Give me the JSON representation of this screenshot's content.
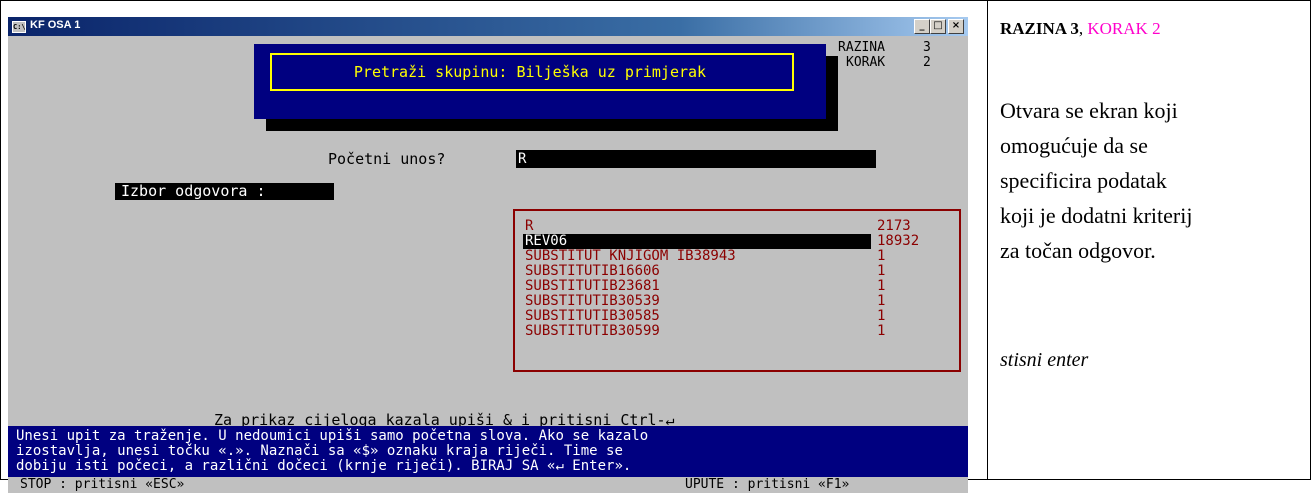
{
  "window": {
    "title": "KF OSA 1",
    "btn_min": "_",
    "btn_max": "□",
    "btn_close": "×"
  },
  "header": {
    "title": "Pretraži skupinu: Bilješka uz primjerak",
    "razina_label": "RAZINA",
    "razina_value": "3",
    "korak_label": "KORAK",
    "korak_value": "2"
  },
  "prompt": {
    "label": "Početni unos?",
    "value": "R"
  },
  "izbor_label": "Izbor odgovora :",
  "results": [
    {
      "name": "R",
      "count": "2173"
    },
    {
      "name": "REV06",
      "count": "18932",
      "selected": true
    },
    {
      "name": "SUBSTITUT KNJIGOM IB38943",
      "count": "1"
    },
    {
      "name": "SUBSTITUTIB16606",
      "count": "1"
    },
    {
      "name": "SUBSTITUTIB23681",
      "count": "1"
    },
    {
      "name": "SUBSTITUTIB30539",
      "count": "1"
    },
    {
      "name": "SUBSTITUTIB30585",
      "count": "1"
    },
    {
      "name": "SUBSTITUTIB30599",
      "count": "1"
    }
  ],
  "hint": "Za prikaz cijeloga kazala upiši & i pritisni Ctrl-↵",
  "help_lines": [
    "Unesi upit za traženje. U nedoumici upiši samo početna slova. Ako se kazalo",
    "izostavlja, unesi točku «.». Naznači sa «$» oznaku kraja riječi. Time se",
    "dobiju isti počeci, a različni dočeci (krnje riječi). BIRAJ SA «↵ Enter»."
  ],
  "status": {
    "left": "STOP : pritisni «ESC»",
    "right": "UPUTE : pritisni «F1»"
  },
  "sidebar": {
    "razina_bold": "RAZINA 3",
    "sep": ",",
    "korak": "KORAK 2",
    "body_lines": [
      "Otvara se ekran koji",
      "omogućuje da se",
      "specificira  podatak",
      "koji je dodatni kriterij",
      "za točan odgovor."
    ],
    "action": "stisni  enter"
  },
  "colors": {
    "console_bg": "#c0c0c0",
    "navy": "#000080",
    "highlight_yellow": "#ffff00",
    "list_red": "#8b0000",
    "pink": "#ff00cc"
  }
}
